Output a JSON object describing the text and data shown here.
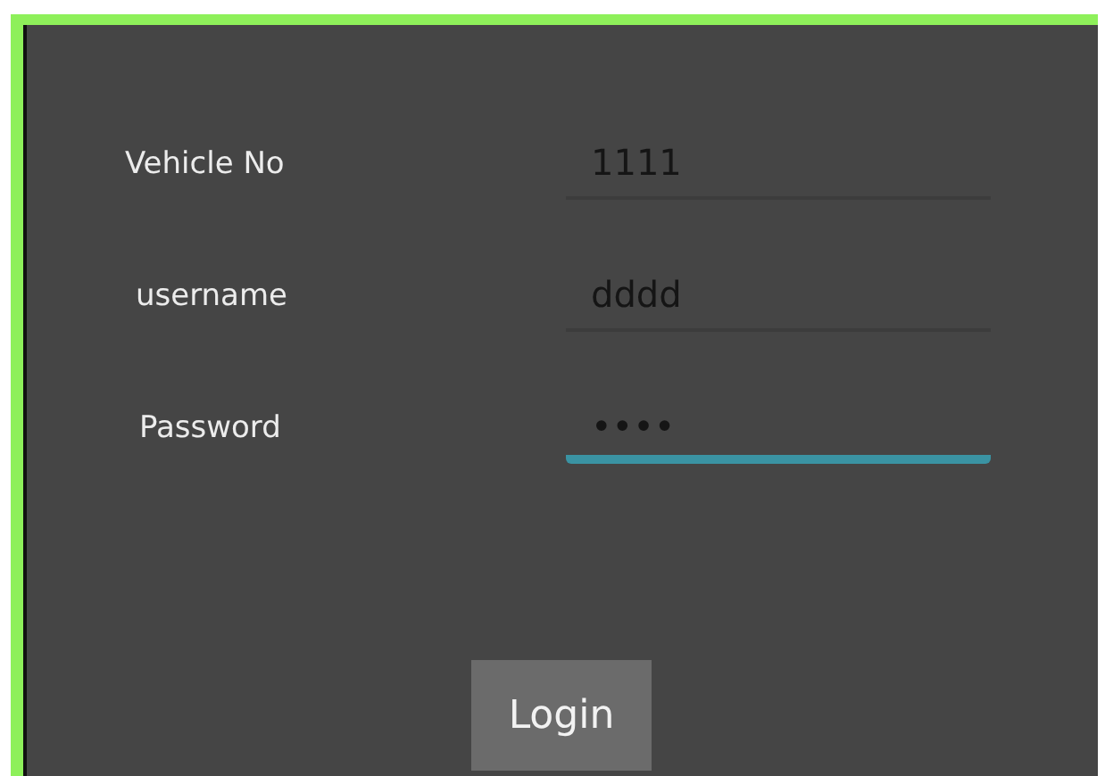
{
  "fields": [
    {
      "label": "Vehicle No",
      "value": "1111",
      "focused": false
    },
    {
      "label": "username",
      "value": "dddd",
      "focused": false
    },
    {
      "label": "Password",
      "value": "••••",
      "focused": true
    }
  ],
  "button": {
    "label": "Login"
  }
}
